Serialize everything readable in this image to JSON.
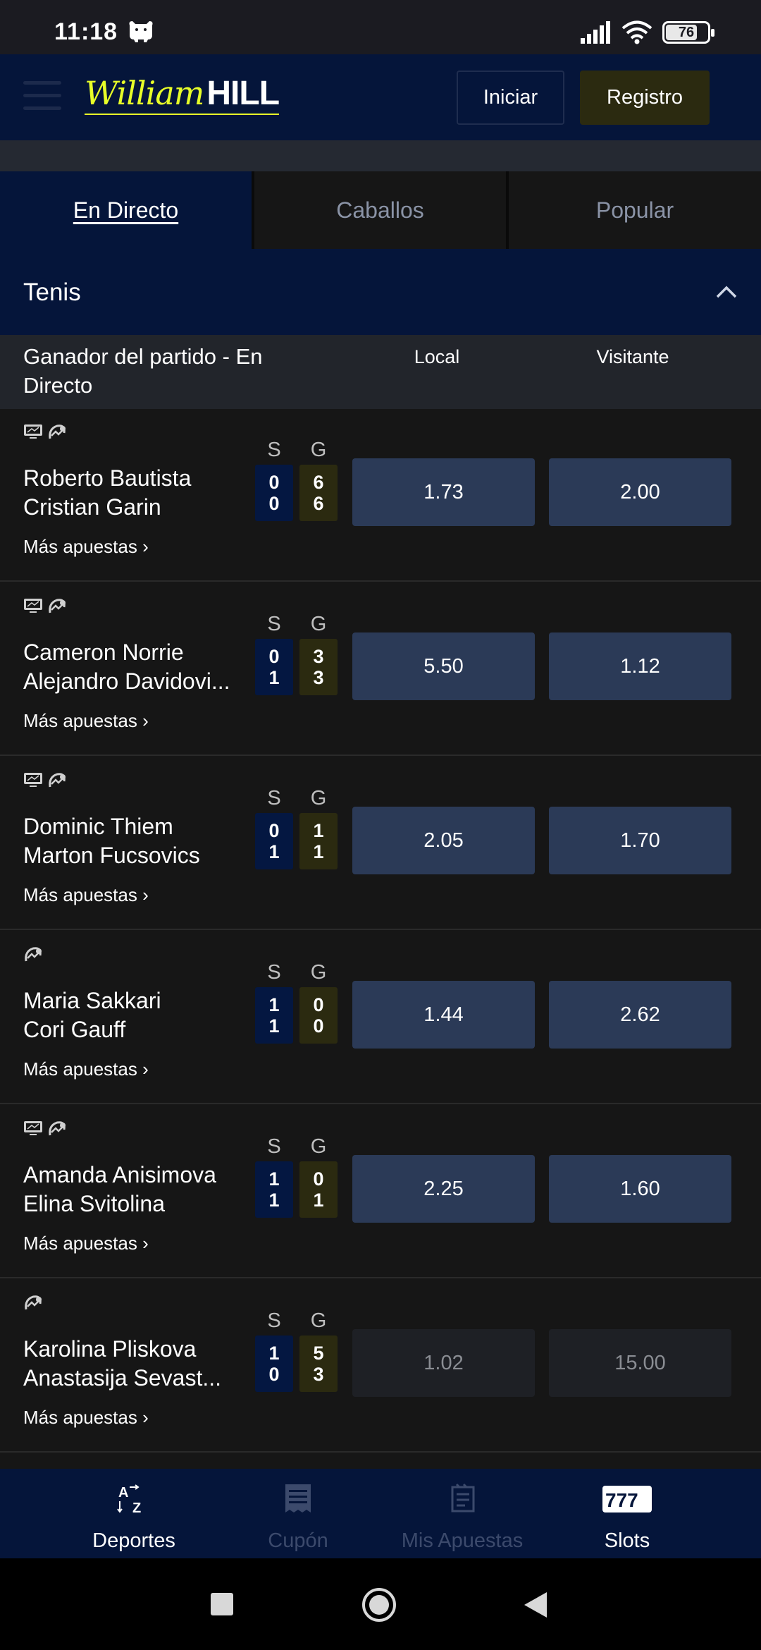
{
  "status": {
    "time": "11:18",
    "battery": "76",
    "battery_level": 0.76
  },
  "header": {
    "login_label": "Iniciar",
    "register_label": "Registro",
    "logo_script": "William",
    "logo_block": "HILL"
  },
  "tabs": [
    {
      "label": "En Directo"
    },
    {
      "label": "Caballos"
    },
    {
      "label": "Popular"
    }
  ],
  "section": {
    "title": "Tenis"
  },
  "market": {
    "title": "Ganador del partido - En Directo",
    "local_label": "Local",
    "visitor_label": "Visitante"
  },
  "score_headers": {
    "sets": "S",
    "games": "G"
  },
  "more_label": "Más apuestas",
  "events": [
    {
      "home": "Roberto Bautista",
      "away": "Cristian Garin",
      "sets": [
        "0",
        "0"
      ],
      "games": [
        "6",
        "6"
      ],
      "odd_home": "1.73",
      "odd_away": "2.00",
      "icons": [
        "tv-icon",
        "stats-icon"
      ],
      "suspended": false
    },
    {
      "home": "Cameron Norrie",
      "away": "Alejandro Davidovi...",
      "sets": [
        "0",
        "1"
      ],
      "games": [
        "3",
        "3"
      ],
      "odd_home": "5.50",
      "odd_away": "1.12",
      "icons": [
        "tv-icon",
        "stats-icon"
      ],
      "suspended": false
    },
    {
      "home": "Dominic Thiem",
      "away": "Marton Fucsovics",
      "sets": [
        "0",
        "1"
      ],
      "games": [
        "1",
        "1"
      ],
      "odd_home": "2.05",
      "odd_away": "1.70",
      "icons": [
        "tv-icon",
        "stats-icon"
      ],
      "suspended": false
    },
    {
      "home": "Maria Sakkari",
      "away": "Cori Gauff",
      "sets": [
        "1",
        "1"
      ],
      "games": [
        "0",
        "0"
      ],
      "odd_home": "1.44",
      "odd_away": "2.62",
      "icons": [
        "stats-icon"
      ],
      "suspended": false
    },
    {
      "home": "Amanda Anisimova",
      "away": "Elina Svitolina",
      "sets": [
        "1",
        "1"
      ],
      "games": [
        "0",
        "1"
      ],
      "odd_home": "2.25",
      "odd_away": "1.60",
      "icons": [
        "tv-icon",
        "stats-icon"
      ],
      "suspended": false
    },
    {
      "home": "Karolina Pliskova",
      "away": "Anastasija Sevast...",
      "sets": [
        "1",
        "0"
      ],
      "games": [
        "5",
        "3"
      ],
      "odd_home": "1.02",
      "odd_away": "15.00",
      "icons": [
        "stats-icon"
      ],
      "suspended": true
    }
  ],
  "bottom_nav": [
    {
      "label": "Deportes",
      "icon": "az-icon",
      "active": true
    },
    {
      "label": "Cupón",
      "icon": "receipt-icon",
      "active": false
    },
    {
      "label": "Mis Apuestas",
      "icon": "bets-icon",
      "active": false
    },
    {
      "label": "Slots",
      "icon": "slots-777-icon",
      "active": true
    }
  ],
  "colors": {
    "header_bg": "#05153a",
    "brand_yellow": "#e8ff28",
    "odd_bg": "#2b3a57",
    "games_bg": "#2b2a10",
    "sets_bg": "#041741"
  }
}
